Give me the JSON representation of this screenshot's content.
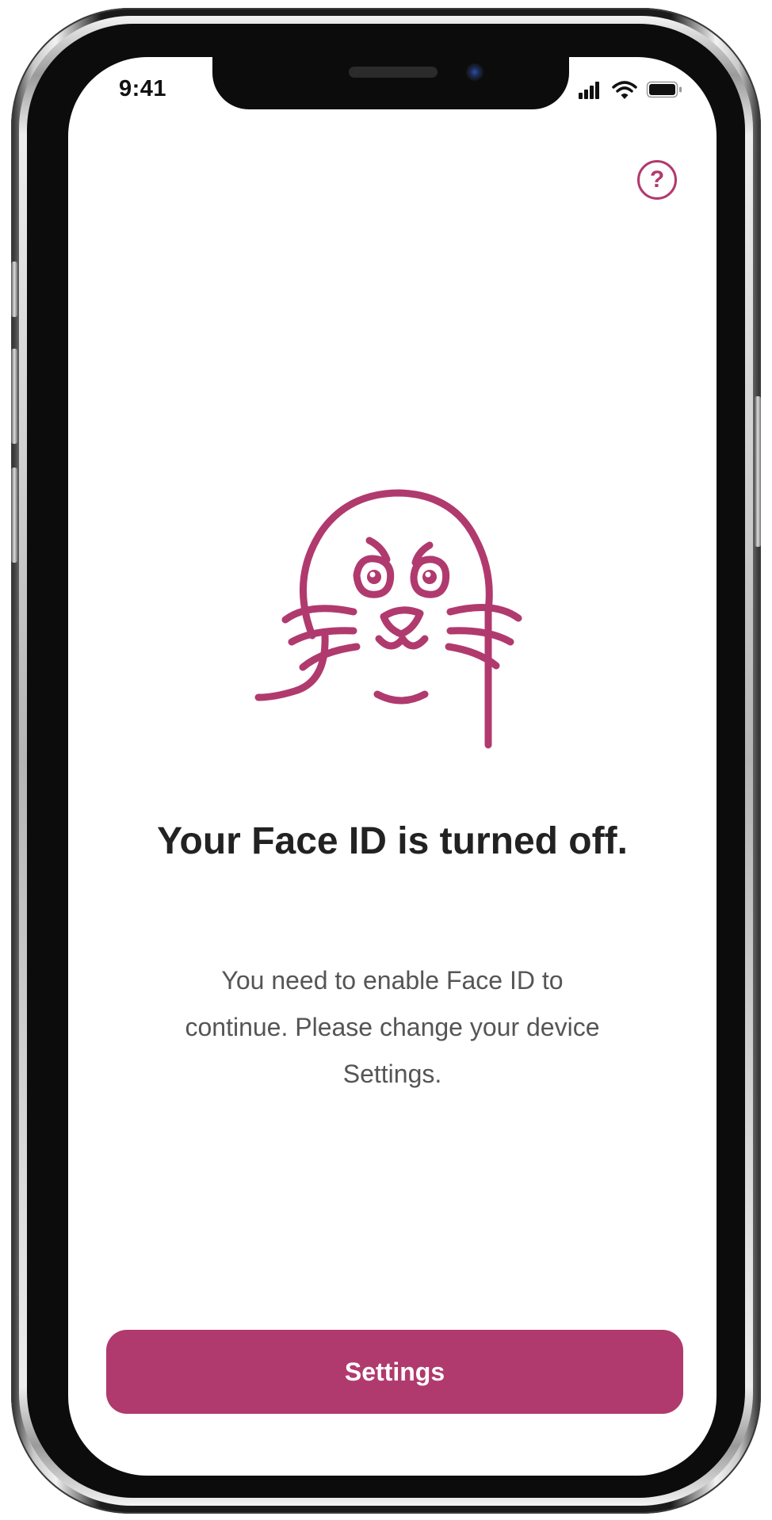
{
  "status_bar": {
    "time": "9:41",
    "signal_icon": "cellular-signal-icon",
    "wifi_icon": "wifi-icon",
    "battery_icon": "battery-icon"
  },
  "help": {
    "label": "?",
    "icon": "help-circle-icon"
  },
  "illustration": {
    "icon": "sad-seal-illustration"
  },
  "title": "Your Face ID is turned off.",
  "message_lines": [
    "You need to enable Face ID to",
    "continue. Please change your device",
    "Settings."
  ],
  "settings_button": {
    "label": "Settings"
  },
  "colors": {
    "accent": "#b03a6e",
    "title_text": "#222222",
    "body_text": "#555555"
  }
}
